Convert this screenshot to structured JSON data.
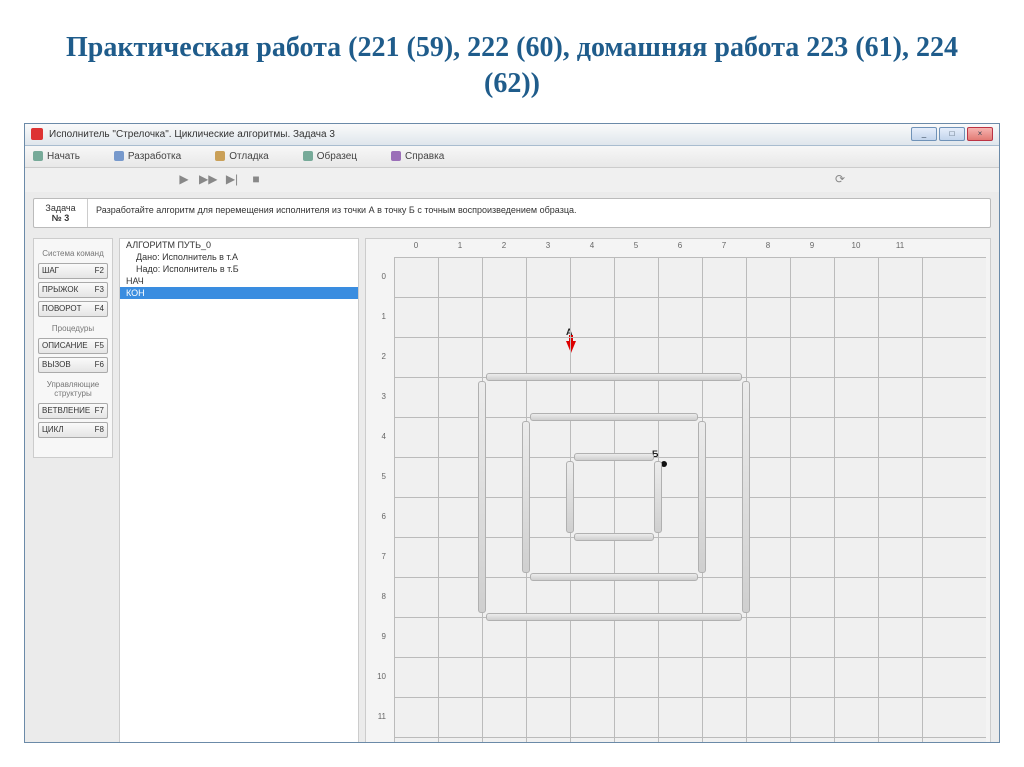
{
  "slide_title": "Практическая работа (221 (59), 222 (60), домашняя работа 223 (61), 224 (62))",
  "window": {
    "title": "Исполнитель \"Стрелочка\". Циклические алгоритмы. Задача 3",
    "btn_min": "_",
    "btn_max": "□",
    "btn_close": "×"
  },
  "menu": {
    "start": "Начать",
    "dev": "Разработка",
    "debug": "Отладка",
    "sample": "Образец",
    "help": "Справка"
  },
  "task": {
    "label_top": "Задача",
    "label_num": "№ 3",
    "text": "Разработайте алгоритм для перемещения исполнителя из точки А в точку Б с точным воспроизведением образца."
  },
  "cmd": {
    "group1": "Система команд",
    "step": "ШАГ",
    "step_k": "F2",
    "jump": "ПРЫЖОК",
    "jump_k": "F3",
    "turn": "ПОВОРОТ",
    "turn_k": "F4",
    "group2": "Процедуры",
    "desc": "ОПИСАНИЕ",
    "desc_k": "F5",
    "call": "ВЫЗОВ",
    "call_k": "F6",
    "group3": "Управляющие структуры",
    "branch": "ВЕТВЛЕНИЕ",
    "branch_k": "F7",
    "cycle": "ЦИКЛ",
    "cycle_k": "F8"
  },
  "code": {
    "l1": "АЛГОРИТМ ПУТЬ_0",
    "l2": "    Дано: Исполнитель в т.А",
    "l3": "    Надо: Исполнитель в т.Б",
    "l4": "НАЧ",
    "l5": "КОН"
  },
  "grid": {
    "cols": [
      "0",
      "1",
      "2",
      "3",
      "4",
      "5",
      "6",
      "7",
      "8",
      "9",
      "10",
      "11"
    ],
    "rows": [
      "0",
      "1",
      "2",
      "3",
      "4",
      "5",
      "6",
      "7",
      "8",
      "9",
      "10",
      "11"
    ],
    "labelA": "А",
    "labelB": "Б"
  }
}
